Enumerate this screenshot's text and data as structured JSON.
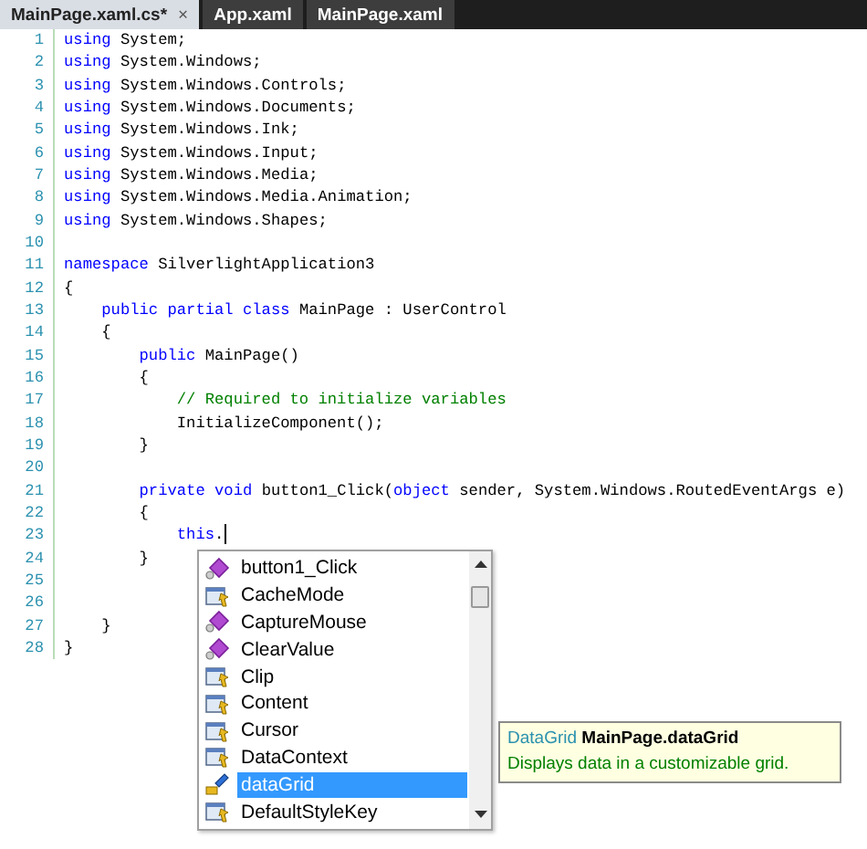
{
  "tabs": [
    {
      "label": "MainPage.xaml.cs*",
      "selected": true,
      "close": "×"
    },
    {
      "label": "App.xaml",
      "selected": false
    },
    {
      "label": "MainPage.xaml",
      "selected": false
    }
  ],
  "code_lines": [
    {
      "number": "1",
      "segments": [
        {
          "kind": "keyword",
          "text": "using"
        },
        {
          "kind": "plain",
          "text": " System;"
        }
      ]
    },
    {
      "number": "2",
      "segments": [
        {
          "kind": "keyword",
          "text": "using"
        },
        {
          "kind": "plain",
          "text": " System.Windows;"
        }
      ]
    },
    {
      "number": "3",
      "segments": [
        {
          "kind": "keyword",
          "text": "using"
        },
        {
          "kind": "plain",
          "text": " System.Windows.Controls;"
        }
      ]
    },
    {
      "number": "4",
      "segments": [
        {
          "kind": "keyword",
          "text": "using"
        },
        {
          "kind": "plain",
          "text": " System.Windows.Documents;"
        }
      ]
    },
    {
      "number": "5",
      "segments": [
        {
          "kind": "keyword",
          "text": "using"
        },
        {
          "kind": "plain",
          "text": " System.Windows.Ink;"
        }
      ]
    },
    {
      "number": "6",
      "segments": [
        {
          "kind": "keyword",
          "text": "using"
        },
        {
          "kind": "plain",
          "text": " System.Windows.Input;"
        }
      ]
    },
    {
      "number": "7",
      "segments": [
        {
          "kind": "keyword",
          "text": "using"
        },
        {
          "kind": "plain",
          "text": " System.Windows.Media;"
        }
      ]
    },
    {
      "number": "8",
      "segments": [
        {
          "kind": "keyword",
          "text": "using"
        },
        {
          "kind": "plain",
          "text": " System.Windows.Media.Animation;"
        }
      ]
    },
    {
      "number": "9",
      "segments": [
        {
          "kind": "keyword",
          "text": "using"
        },
        {
          "kind": "plain",
          "text": " System.Windows.Shapes;"
        }
      ]
    },
    {
      "number": "10"
    },
    {
      "number": "11",
      "segments": [
        {
          "kind": "keyword",
          "text": "namespace"
        },
        {
          "kind": "plain",
          "text": " SilverlightApplication3"
        }
      ]
    },
    {
      "number": "12",
      "segments": [
        {
          "kind": "plain",
          "text": "{"
        }
      ]
    },
    {
      "number": "13",
      "segments": [
        {
          "kind": "keyword",
          "text": "    public partial class"
        },
        {
          "kind": "plain",
          "text": " MainPage : UserControl"
        }
      ]
    },
    {
      "number": "14",
      "segments": [
        {
          "kind": "plain",
          "text": "    {"
        }
      ]
    },
    {
      "number": "15",
      "segments": [
        {
          "kind": "keyword",
          "text": "        public"
        },
        {
          "kind": "plain",
          "text": " MainPage()"
        }
      ]
    },
    {
      "number": "16",
      "segments": [
        {
          "kind": "plain",
          "text": "        {"
        }
      ]
    },
    {
      "number": "17",
      "segments": [
        {
          "kind": "comment",
          "text": "            // Required to initialize variables"
        }
      ]
    },
    {
      "number": "18",
      "segments": [
        {
          "kind": "plain",
          "text": "            InitializeComponent();"
        }
      ]
    },
    {
      "number": "19",
      "segments": [
        {
          "kind": "plain",
          "text": "        }"
        }
      ]
    },
    {
      "number": "20"
    },
    {
      "number": "21",
      "segments": [
        {
          "kind": "keyword",
          "text": "        private void"
        },
        {
          "kind": "plain",
          "text": " button1_Click("
        },
        {
          "kind": "keyword",
          "text": "object"
        },
        {
          "kind": "plain",
          "text": " sender, System.Windows.RoutedEventArgs e)"
        }
      ]
    },
    {
      "number": "22",
      "segments": [
        {
          "kind": "plain",
          "text": "        {"
        }
      ]
    },
    {
      "number": "23",
      "segments": [
        {
          "kind": "keyword",
          "text": "            this"
        },
        {
          "kind": "plain",
          "text": "."
        }
      ],
      "caret": true
    },
    {
      "number": "24",
      "segments": [
        {
          "kind": "plain",
          "text": "        }"
        }
      ]
    },
    {
      "number": "25"
    },
    {
      "number": "26"
    },
    {
      "number": "27",
      "segments": [
        {
          "kind": "plain",
          "text": "    }"
        }
      ]
    },
    {
      "number": "28",
      "segments": [
        {
          "kind": "plain",
          "text": "}"
        }
      ]
    }
  ],
  "completion": {
    "items": [
      {
        "label": "button1_Click",
        "kind": "method",
        "selected": false
      },
      {
        "label": "CacheMode",
        "kind": "property",
        "selected": false
      },
      {
        "label": "CaptureMouse",
        "kind": "method",
        "selected": false
      },
      {
        "label": "ClearValue",
        "kind": "method",
        "selected": false
      },
      {
        "label": "Clip",
        "kind": "property",
        "selected": false
      },
      {
        "label": "Content",
        "kind": "property",
        "selected": false
      },
      {
        "label": "Cursor",
        "kind": "property",
        "selected": false
      },
      {
        "label": "DataContext",
        "kind": "property",
        "selected": false
      },
      {
        "label": "dataGrid",
        "kind": "field",
        "selected": true
      },
      {
        "label": "DefaultStyleKey",
        "kind": "property",
        "selected": false
      }
    ]
  },
  "tooltip": {
    "type": "DataGrid",
    "name": "MainPage.dataGrid",
    "description": "Displays data in a customizable grid."
  }
}
